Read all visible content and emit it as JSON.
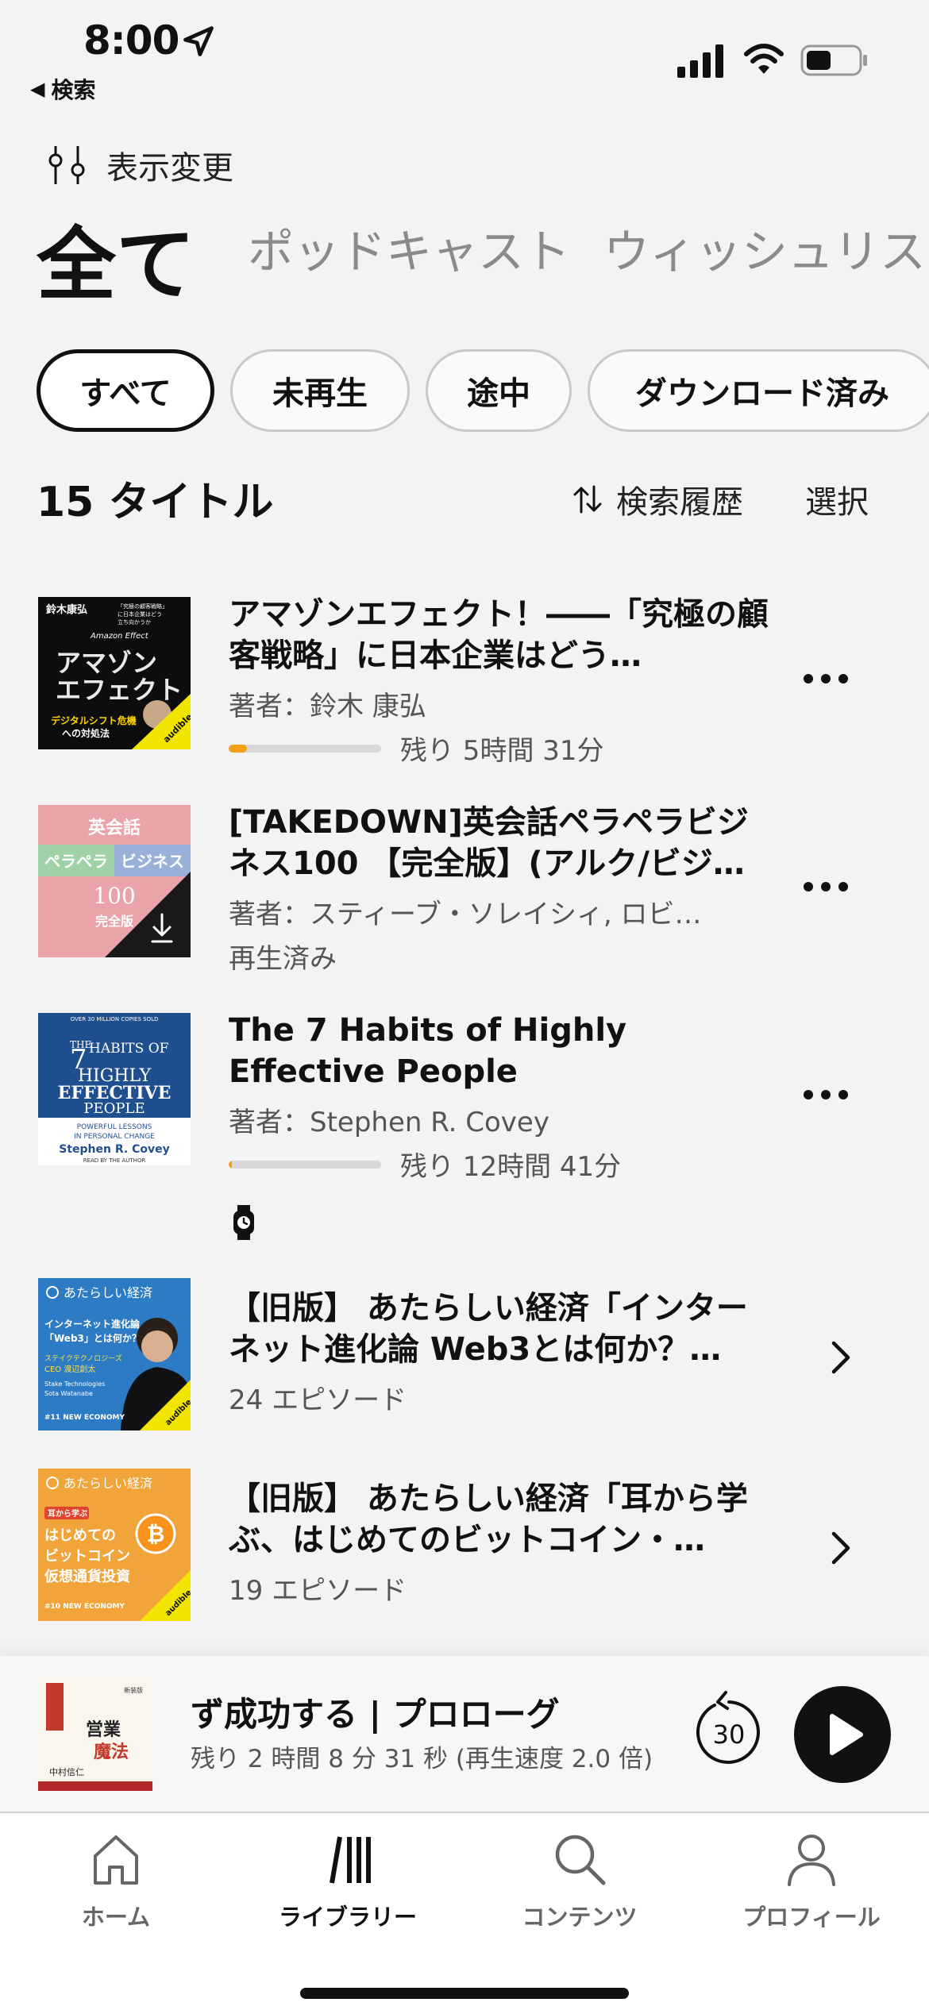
{
  "status_bar": {
    "time": "8:00",
    "back_label": "検索"
  },
  "view_toggle": {
    "label": "表示変更",
    "icon": "sliders-icon"
  },
  "top_tabs": [
    {
      "label": "全て",
      "active": true
    },
    {
      "label": "ポッドキャスト",
      "active": false
    },
    {
      "label": "ウィッシュリスト",
      "active": false
    }
  ],
  "filters": [
    {
      "label": "すべて",
      "active": true
    },
    {
      "label": "未再生",
      "active": false
    },
    {
      "label": "途中",
      "active": false
    },
    {
      "label": "ダウンロード済み",
      "active": false
    }
  ],
  "list_header": {
    "count": "15 タイトル",
    "sort_label": "検索履歴",
    "select_label": "選択"
  },
  "items": [
    {
      "title": "アマゾンエフェクト！――「究極の顧客戦略」に日本企業はどう…",
      "author": "著者：鈴木 康弘",
      "progress": 0.12,
      "remaining": "残り 5時間 31分",
      "cover": {
        "author": "鈴木康弘",
        "tagline": "「究極の顧客戦略」に日本企業はどう立ち向かうか",
        "brand": "Amazon Effect",
        "big": "アマゾン\nエフェクト",
        "sub": "デジタルシフト危機への対処法",
        "badge": "ONLY FROM audible"
      }
    },
    {
      "title": "[TAKEDOWN]英会話ペラペラビジネス100 【完全版】(アルク/ビジ…",
      "author": "著者：スティーブ・ソレイシィ, ロビ…",
      "status": "再生済み",
      "cover": {
        "line1": "英会話",
        "line2a": "ペラペラ",
        "line2b": "ビジネス",
        "line3": "100",
        "line4": "完全版"
      }
    },
    {
      "title": "The 7 Habits of Highly Effective People",
      "author": "著者：Stephen R. Covey",
      "progress": 0.02,
      "remaining": "残り 12時間 41分",
      "cover": {
        "top": "OVER 30 MILLION COPIES SOLD",
        "the": "THE",
        "num": "7",
        "habits": "HABITS OF",
        "highly": "HIGHLY",
        "effective": "EFFECTIVE",
        "people": "PEOPLE",
        "tag1": "POWERFUL LESSONS",
        "tag2": "IN PERSONAL CHANGE",
        "author": "Stephen R. Covey",
        "read": "READ BY THE AUTHOR"
      }
    },
    {
      "title": "【旧版】 あたらしい経済「インターネット進化論 Web3とは何か？…",
      "episodes": "24 エピソード",
      "cover": {
        "header": "あたらしい経済",
        "q1": "インターネット進化論",
        "q2": "「Web3」とは何か？",
        "company": "ステイクテクノロジーズ",
        "ceo": "CEO 渡辺創太",
        "name1": "Stake Technologies",
        "name2": "Sota Watanabe",
        "tag": "#11 NEW ECONOMY",
        "badge": "ONLY FROM audible"
      }
    },
    {
      "title": "【旧版】 あたらしい経済「耳から学ぶ、はじめてのビットコイン・…",
      "episodes": "19 エピソード",
      "cover": {
        "header": "あたらしい経済",
        "ear": "耳から学ぶ",
        "l1": "はじめての",
        "l2": "ビットコイン",
        "l3": "仮想通貨投資",
        "tag": "#10 NEW ECONOMY",
        "badge": "ONLY FROM audible"
      }
    }
  ],
  "mini_player": {
    "title": "ず成功する | プロローグ",
    "subtitle": "残り 2 時間 8 分 31 秒 (再生速度 2.0 倍)",
    "skip_seconds": "30",
    "cover": {
      "big": "営業の魔法",
      "author": "中村信仁"
    }
  },
  "tab_bar": [
    {
      "label": "ホーム",
      "icon": "home-icon",
      "active": false
    },
    {
      "label": "ライブラリー",
      "icon": "library-icon",
      "active": true
    },
    {
      "label": "コンテンツ",
      "icon": "search-icon",
      "active": false
    },
    {
      "label": "プロフィール",
      "icon": "person-icon",
      "active": false
    }
  ],
  "colors": {
    "accent": "#f3a11b",
    "background": "#f3f3f5",
    "text": "#111111",
    "muted": "#555555"
  }
}
